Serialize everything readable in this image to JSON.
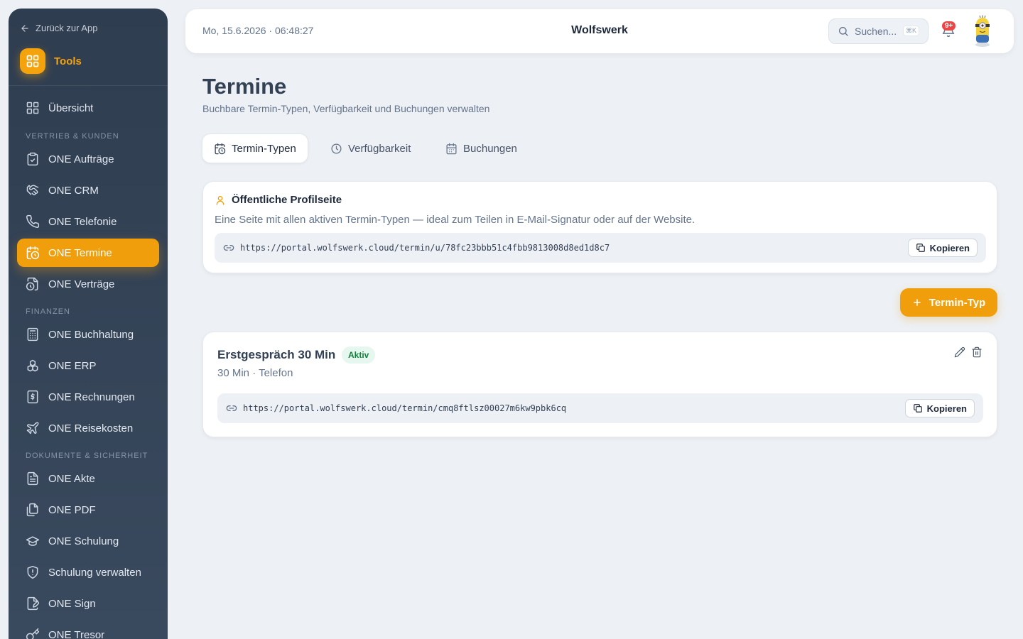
{
  "sidebar": {
    "back_label": "Zurück zur App",
    "tools_label": "Tools",
    "overview": "Übersicht",
    "sections": [
      "VERTRIEB & KUNDEN",
      "FINANZEN",
      "DOKUMENTE & SICHERHEIT"
    ],
    "items": [
      {
        "label": "ONE Aufträge",
        "icon": "clipboard-check-icon"
      },
      {
        "label": "ONE CRM",
        "icon": "handshake-icon"
      },
      {
        "label": "ONE Telefonie",
        "icon": "phone-icon"
      },
      {
        "label": "ONE Termine",
        "icon": "calendar-clock-icon",
        "active": true
      },
      {
        "label": "ONE Verträge",
        "icon": "file-clock-icon"
      },
      {
        "label": "ONE Buchhaltung",
        "icon": "calculator-icon"
      },
      {
        "label": "ONE ERP",
        "icon": "boxes-icon"
      },
      {
        "label": "ONE Rechnungen",
        "icon": "receipt-icon"
      },
      {
        "label": "ONE Reisekosten",
        "icon": "plane-icon"
      },
      {
        "label": "ONE Akte",
        "icon": "file-text-icon"
      },
      {
        "label": "ONE PDF",
        "icon": "files-icon"
      },
      {
        "label": "ONE Schulung",
        "icon": "graduation-cap-icon"
      },
      {
        "label": "Schulung verwalten",
        "icon": "shield-alert-icon"
      },
      {
        "label": "ONE Sign",
        "icon": "file-signature-icon"
      },
      {
        "label": "ONE Tresor",
        "icon": "key-icon"
      }
    ]
  },
  "header": {
    "datetime": "Mo, 15.6.2026 · 06:48:27",
    "brand": "Wolfswerk",
    "search_placeholder": "Suchen...",
    "search_shortcut": "⌘K",
    "notification_count": "9+"
  },
  "main": {
    "title": "Termine",
    "subtitle": "Buchbare Termin-Typen, Verfügbarkeit und Buchungen verwalten",
    "tabs": [
      {
        "label": "Termin-Typen",
        "active": true
      },
      {
        "label": "Verfügbarkeit"
      },
      {
        "label": "Buchungen"
      }
    ],
    "profile": {
      "title": "Öffentliche Profilseite",
      "description": "Eine Seite mit allen aktiven Termin-Typen — ideal zum Teilen in E-Mail-Signatur oder auf der Website.",
      "url": "https://portal.wolfswerk.cloud/termin/u/78fc23bbb51c4fbb9813008d8ed1d8c7",
      "copy_label": "Kopieren"
    },
    "add_label": "Termin-Typ",
    "types": [
      {
        "name": "Erstgespräch 30 Min",
        "status": "Aktiv",
        "meta": "30 Min · Telefon",
        "url": "https://portal.wolfswerk.cloud/termin/cmq8ftlsz00027m6kw9pbk6cq",
        "copy_label": "Kopieren"
      }
    ]
  },
  "colors": {
    "accent": "#f09e0c",
    "sidebar_bg": "#33435a",
    "status_bg": "#e5f7ee",
    "status_text": "#15803d"
  }
}
